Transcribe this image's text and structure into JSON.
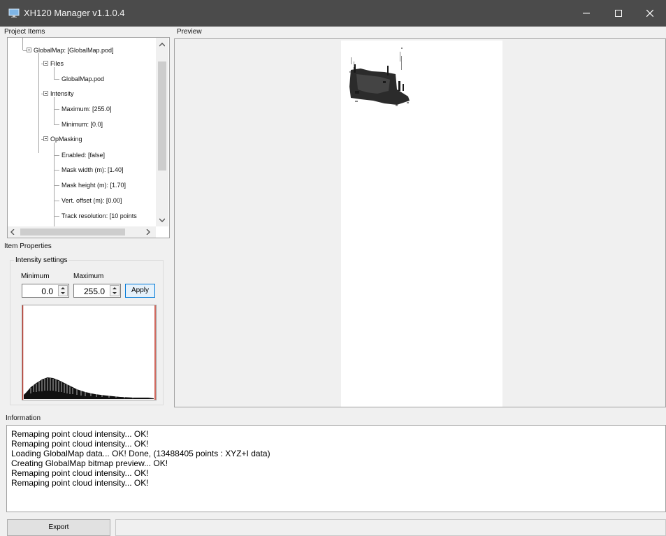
{
  "window": {
    "title": "XH120 Manager v1.1.0.4",
    "icon": "app-monitor-icon",
    "controls": [
      "minimize-icon",
      "maximize-icon",
      "close-icon"
    ]
  },
  "sections": {
    "project_items": "Project Items",
    "preview": "Preview",
    "item_properties": "Item Properties",
    "information": "Information"
  },
  "tree": {
    "root": "GlobalMap: [GlobalMap.pod]",
    "files_label": "Files",
    "file": "GlobalMap.pod",
    "intensity_label": "Intensity",
    "maximum": "Maximum: [255.0]",
    "minimum": "Minimum: [0.0]",
    "opmasking_label": "OpMasking",
    "enabled": "Enabled: [false]",
    "mask_width": "Mask width (m): [1.40]",
    "mask_height": "Mask height (m): [1.70]",
    "vert_offset": "Vert. offset (m): [0.00]",
    "track_resolution": "Track resolution: [10 points"
  },
  "intensity_settings": {
    "caption": "Intensity settings",
    "min_label": "Minimum",
    "max_label": "Maximum",
    "min_value": "0.0",
    "max_value": "255.0",
    "apply_label": "Apply"
  },
  "log": [
    "Remaping point cloud intensity... OK!",
    "Remaping point cloud intensity... OK!",
    "Loading GlobalMap data... OK! Done, (13488405 points : XYZ+I data)",
    "Creating GlobalMap bitmap preview... OK!",
    "Remaping point cloud intensity... OK!",
    "Remaping point cloud intensity... OK!"
  ],
  "export_label": "Export",
  "colors": {
    "titlebar": "#4b4b4b",
    "accent": "#0078d7",
    "histogram_marker": "#c0392b"
  }
}
